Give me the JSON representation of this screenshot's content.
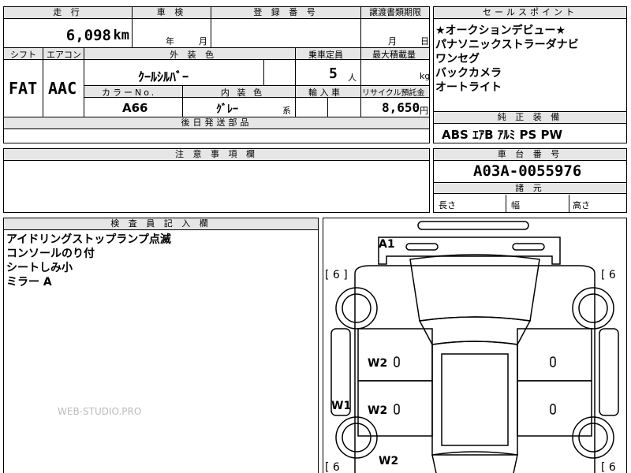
{
  "top_fragment": "",
  "headers": {
    "mileage": "走 行",
    "inspection": "車 検",
    "registration": "登 録 番 号",
    "transfer_deadline": "譲渡書類期限",
    "selling_points": "セールスポイント",
    "shift": "シフト",
    "aircon": "エアコン",
    "exterior_color": "外 装 色",
    "capacity": "乗車定員",
    "max_load": "最大積載量",
    "color_no": "カラーNo.",
    "interior_color": "内 装 色",
    "import": "輸 入 車",
    "recycle": "リサイクル預託金",
    "later_parts": "後日発送部品",
    "genuine_equipment": "純 正 装 備",
    "notes": "注 意 事 項 欄",
    "chassis": "車 台 番 号",
    "dimensions": "諸 元",
    "inspector": "検 査 員 記 入 欄"
  },
  "mileage": {
    "value": "6,098",
    "unit": "km"
  },
  "inspection": {
    "year": "年",
    "month": "月"
  },
  "transfer": {
    "month": "月",
    "day": "日"
  },
  "shift": "FAT",
  "aircon": "AAC",
  "exterior_color": "ｸｰﾙｼﾙﾊﾞｰ",
  "capacity": {
    "value": "5",
    "unit": "人"
  },
  "max_load_unit": "kg",
  "color_no": "A66",
  "interior_color": {
    "value": "ｸﾞﾚｰ",
    "suffix": "系"
  },
  "recycle": {
    "value": "8,650",
    "unit": "円"
  },
  "selling_points": [
    "★オークションデビュー★",
    "パナソニックストラーダナビ",
    "ワンセグ",
    "バックカメラ",
    "オートライト"
  ],
  "equipment": "ABS ｴｱB ｱﾙﾐ PS PW",
  "chassis_number": "A03A-0055976",
  "dimensions": {
    "length": "長さ",
    "width": "幅",
    "height": "高さ"
  },
  "inspector_notes": [
    "アイドリングストップランプ点滅",
    "コンソールのり付",
    "シートしみ小",
    "ミラー A"
  ],
  "diagram": {
    "labels": {
      "a1": "A1",
      "w2_left_upper": "W2",
      "w2_left_mid": "W2",
      "w1": "W1",
      "w2_left_lower": "W2",
      "bracket_tl": "[ 6 ]",
      "bracket_tr": "[ 6",
      "bracket_bl": "[ 6",
      "bracket_br": "[ 6"
    }
  },
  "watermark": "WEB-STUDIO.PRO"
}
